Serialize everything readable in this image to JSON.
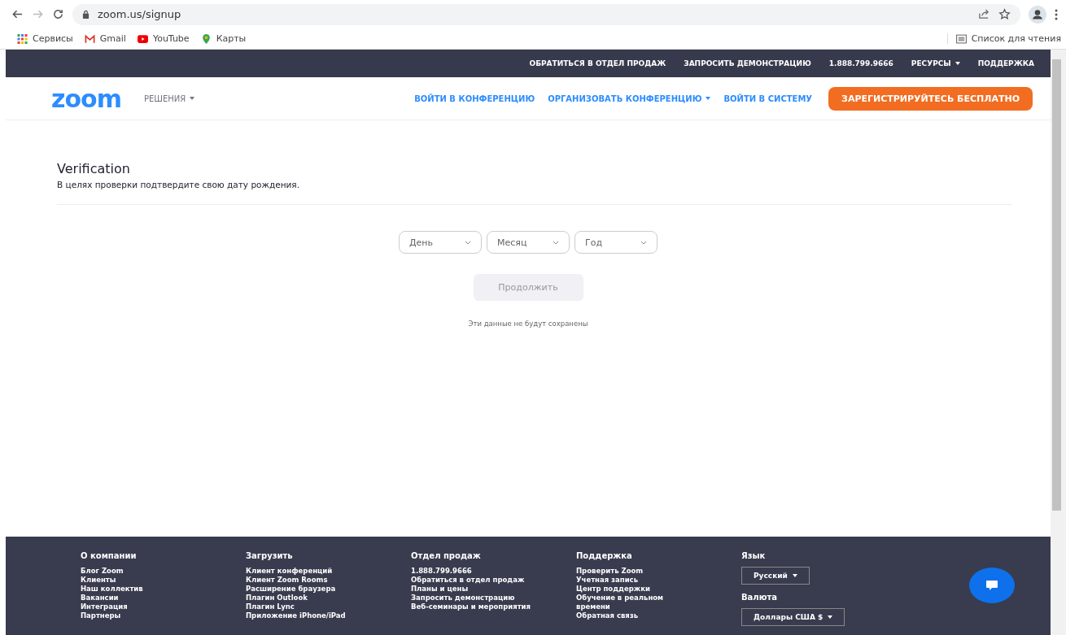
{
  "browser": {
    "url": "zoom.us/signup",
    "bookmarks": [
      {
        "kind": "apps",
        "label": "Сервисы"
      },
      {
        "kind": "gmail",
        "label": "Gmail"
      },
      {
        "kind": "youtube",
        "label": "YouTube"
      },
      {
        "kind": "maps",
        "label": "Карты"
      }
    ],
    "reading_list": "Список для чтения"
  },
  "top_bar": {
    "links": [
      {
        "label": "ОБРАТИТЬСЯ В ОТДЕЛ ПРОДАЖ",
        "dropdown": false
      },
      {
        "label": "ЗАПРОСИТЬ ДЕМОНСТРАЦИЮ",
        "dropdown": false
      },
      {
        "label": "1.888.799.9666",
        "dropdown": false
      },
      {
        "label": "РЕСУРСЫ",
        "dropdown": true
      },
      {
        "label": "ПОДДЕРЖКА",
        "dropdown": false
      }
    ]
  },
  "nav": {
    "logo": "zoom",
    "solutions": "РЕШЕНИЯ",
    "links": [
      {
        "label": "ВОЙТИ В КОНФЕРЕНЦИЮ",
        "dropdown": false
      },
      {
        "label": "ОРГАНИЗОВАТЬ КОНФЕРЕНЦИЮ",
        "dropdown": true
      },
      {
        "label": "ВОЙТИ В СИСТЕМУ",
        "dropdown": false
      }
    ],
    "signup_button": "ЗАРЕГИСТРИРУЙТЕСЬ БЕСПЛАТНО"
  },
  "verification": {
    "title": "Verification",
    "subtitle": "В целях проверки подтвердите свою дату рождения.",
    "selects": [
      {
        "placeholder": "День"
      },
      {
        "placeholder": "Месяц"
      },
      {
        "placeholder": "Год"
      }
    ],
    "continue_button": {
      "label": "Продолжить",
      "disabled": true
    },
    "note": "Эти данные не будут сохранены"
  },
  "footer": {
    "columns": [
      {
        "heading": "О компании",
        "links": [
          "Блог Zoom",
          "Клиенты",
          "Наш коллектив",
          "Вакансии",
          "Интеграция",
          "Партнеры"
        ]
      },
      {
        "heading": "Загрузить",
        "links": [
          "Клиент конференций",
          "Клиент Zoom Rooms",
          "Расширение браузера",
          "Плагин Outlook",
          "Плагин Lync",
          "Приложение iPhone/iPad"
        ]
      },
      {
        "heading": "Отдел продаж",
        "links": [
          "1.888.799.9666",
          "Обратиться в отдел продаж",
          "Планы и цены",
          "Запросить демонстрацию",
          "Веб-семинары и мероприятия"
        ]
      },
      {
        "heading": "Поддержка",
        "links": [
          "Проверить Zoom",
          "Учетная запись",
          "Центр поддержки",
          "Обучение в реальном времени",
          "Обратная связь"
        ]
      }
    ],
    "language": {
      "heading": "Язык",
      "value": "Русский"
    },
    "currency": {
      "heading": "Валюта",
      "value": "Доллары США $"
    }
  }
}
